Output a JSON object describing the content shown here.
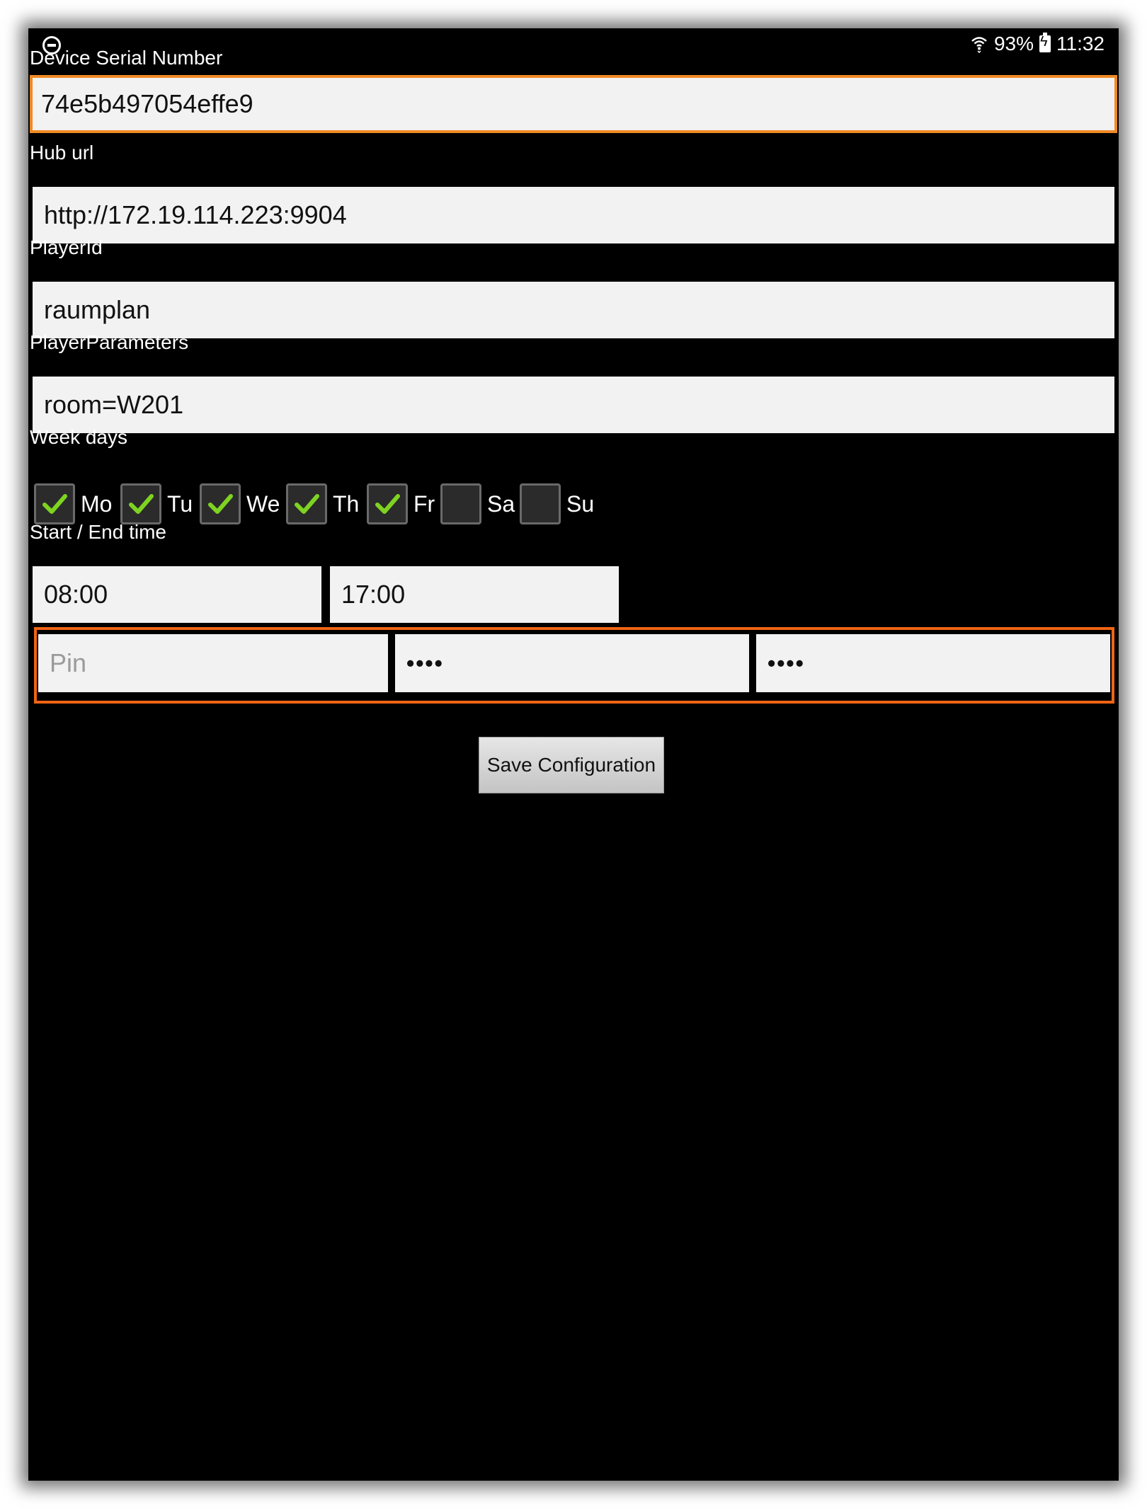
{
  "status_bar": {
    "battery_percent": "93%",
    "time": "11:32",
    "icons": [
      "do-not-disturb-icon",
      "wifi-icon",
      "battery-charging-icon"
    ]
  },
  "form": {
    "serial": {
      "label": "Device Serial Number",
      "value": "74e5b497054effe9"
    },
    "hub_url": {
      "label": "Hub url",
      "value": "http://172.19.114.223:9904"
    },
    "player_id": {
      "label": "PlayerId",
      "value": "raumplan"
    },
    "player_params": {
      "label": "PlayerParameters",
      "value": "room=W201"
    },
    "week_days": {
      "label": "Week days",
      "days": [
        {
          "label": "Mo",
          "checked": true
        },
        {
          "label": "Tu",
          "checked": true
        },
        {
          "label": "We",
          "checked": true
        },
        {
          "label": "Th",
          "checked": true
        },
        {
          "label": "Fr",
          "checked": true
        },
        {
          "label": "Sa",
          "checked": false
        },
        {
          "label": "Su",
          "checked": false
        }
      ]
    },
    "time_range": {
      "label": "Start / End time",
      "start": "08:00",
      "end": "17:00"
    },
    "pin": {
      "placeholder": "Pin",
      "new_pin": "••••",
      "confirm_pin": "••••"
    },
    "save_label": "Save Configuration"
  },
  "colors": {
    "background": "#000000",
    "field_background": "#f2f2f2",
    "focus_border": "#f08a24",
    "highlight_border": "#f06414",
    "check_green": "#7ed321"
  }
}
